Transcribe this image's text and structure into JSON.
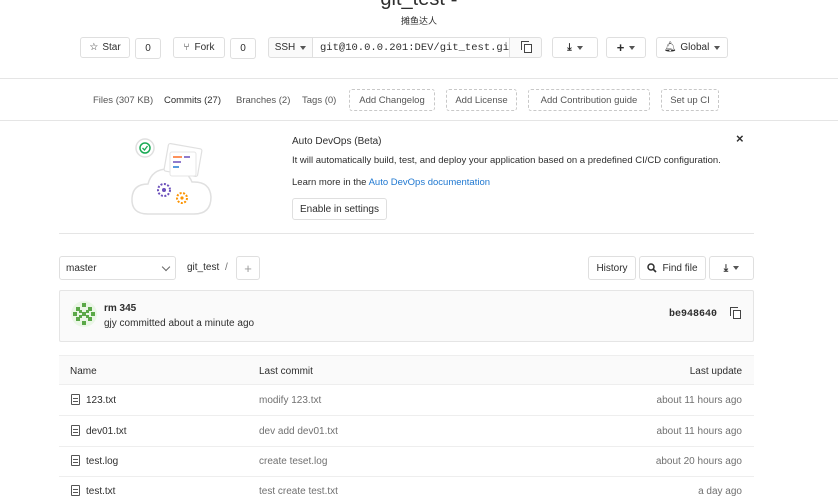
{
  "project": {
    "title": "git_test ▪",
    "description": "摊鱼达人"
  },
  "header_controls": {
    "star_label": "Star",
    "star_count": "0",
    "fork_label": "Fork",
    "fork_count": "0",
    "clone_protocol": "SSH",
    "clone_url": "git@10.0.0.201:DEV/git_test.gi",
    "notification_label": "Global"
  },
  "stats": {
    "files": "Files (307 KB)",
    "commits": "Commits (27)",
    "branches": "Branches (2)",
    "tags": "Tags (0)",
    "add_changelog": "Add Changelog",
    "add_license": "Add License",
    "add_contribution": "Add Contribution guide",
    "setup_ci": "Set up CI"
  },
  "auto_devops": {
    "title": "Auto DevOps (Beta)",
    "text": "It will automatically build, test, and deploy your application based on a predefined CI/CD configuration.",
    "learn_prefix": "Learn more in the ",
    "learn_link": "Auto DevOps documentation",
    "enable_button": "Enable in settings",
    "close": "×"
  },
  "repo_nav": {
    "branch": "master",
    "path": "git_test",
    "path_sep": "/",
    "add": "+",
    "history": "History",
    "find_file": "Find file"
  },
  "last_commit": {
    "message": "rm 345",
    "author_line": "gjy committed about a minute ago",
    "sha": "be948640"
  },
  "files_table": {
    "headers": {
      "name": "Name",
      "last_commit": "Last commit",
      "last_update": "Last update"
    },
    "rows": [
      {
        "name": "123.txt",
        "commit": "modify 123.txt",
        "updated": "about 11 hours ago"
      },
      {
        "name": "dev01.txt",
        "commit": "dev add dev01.txt",
        "updated": "about 11 hours ago"
      },
      {
        "name": "test.log",
        "commit": "create teset.log",
        "updated": "about 20 hours ago"
      },
      {
        "name": "test.txt",
        "commit": "test create test.txt",
        "updated": "a day ago"
      }
    ]
  },
  "colors": {
    "link": "#1f78d1",
    "border": "#dfdfdf",
    "muted": "#707070",
    "success": "#1aaa55",
    "ops_orange": "#fc9403"
  }
}
